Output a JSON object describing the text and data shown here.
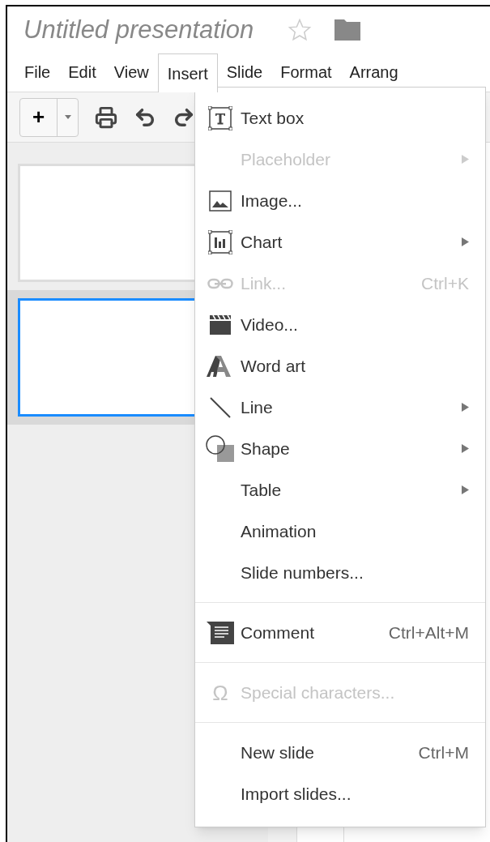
{
  "document": {
    "title": "Untitled presentation",
    "starred": false
  },
  "menubar": [
    {
      "label": "File",
      "selected": false
    },
    {
      "label": "Edit",
      "selected": false
    },
    {
      "label": "View",
      "selected": false
    },
    {
      "label": "Insert",
      "selected": true
    },
    {
      "label": "Slide",
      "selected": false
    },
    {
      "label": "Format",
      "selected": false
    },
    {
      "label": "Arrang",
      "selected": false
    }
  ],
  "toolbar": {
    "new_button": "+"
  },
  "slides": [
    {
      "selected": false
    },
    {
      "selected": true
    }
  ],
  "insert_menu": {
    "sections": [
      [
        {
          "label": "Text box",
          "disabled": false,
          "submenu": false
        },
        {
          "label": "Placeholder",
          "disabled": true,
          "submenu": true
        },
        {
          "label": "Image...",
          "disabled": false,
          "submenu": false
        },
        {
          "label": "Chart",
          "disabled": false,
          "submenu": true
        },
        {
          "label": "Link...",
          "disabled": true,
          "submenu": false,
          "shortcut": "Ctrl+K"
        },
        {
          "label": "Video...",
          "disabled": false,
          "submenu": false
        },
        {
          "label": "Word art",
          "disabled": false,
          "submenu": false
        },
        {
          "label": "Line",
          "disabled": false,
          "submenu": true
        },
        {
          "label": "Shape",
          "disabled": false,
          "submenu": true
        },
        {
          "label": "Table",
          "disabled": false,
          "submenu": true
        },
        {
          "label": "Animation",
          "disabled": false,
          "submenu": false
        },
        {
          "label": "Slide numbers...",
          "disabled": false,
          "submenu": false
        }
      ],
      [
        {
          "label": "Comment",
          "disabled": false,
          "submenu": false,
          "shortcut": "Ctrl+Alt+M"
        }
      ],
      [
        {
          "label": "Special characters...",
          "disabled": true,
          "submenu": false,
          "icon_char": "Ω"
        }
      ],
      [
        {
          "label": "New slide",
          "disabled": false,
          "submenu": false,
          "shortcut": "Ctrl+M"
        },
        {
          "label": "Import slides...",
          "disabled": false,
          "submenu": false
        }
      ]
    ]
  }
}
